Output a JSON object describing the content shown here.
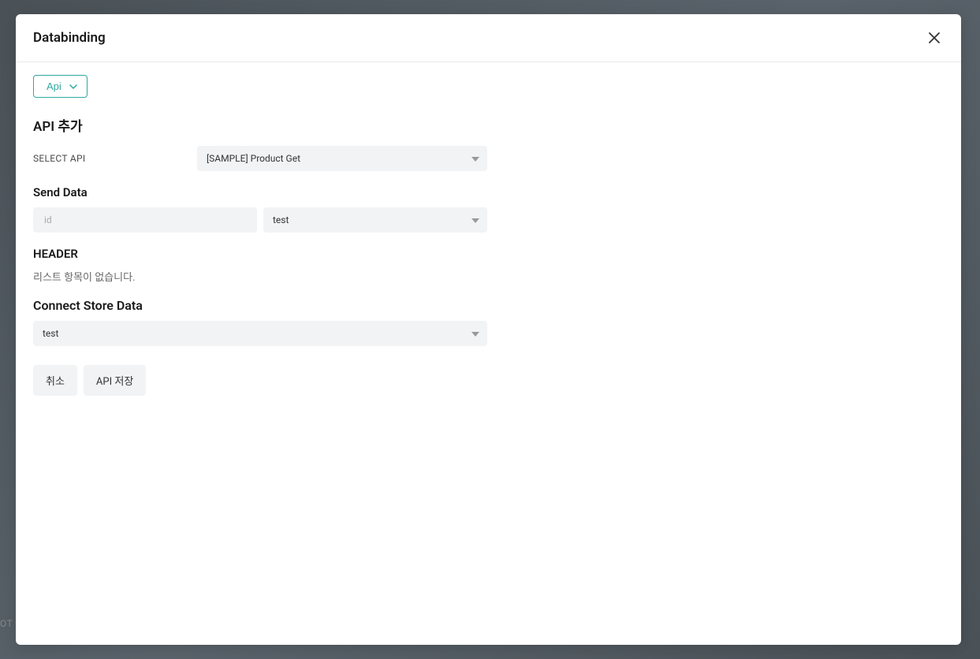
{
  "modal": {
    "title": "Databinding"
  },
  "background": {
    "partial_text": "OT"
  },
  "type_selector": {
    "label": "Api"
  },
  "sections": {
    "add_api": {
      "title": "API 추가",
      "select_api_label": "SELECT API",
      "select_api_value": "[SAMPLE] Product Get"
    },
    "send_data": {
      "title": "Send Data",
      "input_placeholder": "id",
      "select_value": "test"
    },
    "header": {
      "title": "HEADER",
      "empty_message": "리스트 항목이 없습니다."
    },
    "connect_store": {
      "title": "Connect Store Data",
      "select_value": "test"
    }
  },
  "buttons": {
    "cancel": "취소",
    "save": "API 저장"
  }
}
